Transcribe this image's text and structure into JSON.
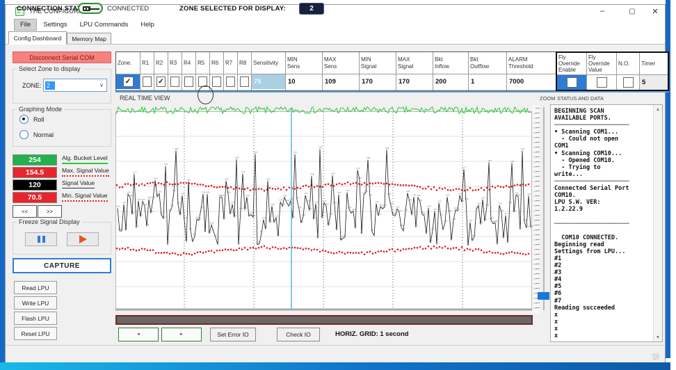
{
  "window": {
    "title": "THE CONFIGURATOR",
    "minimize": "–",
    "maximize": "▢",
    "close": "✕"
  },
  "menu": {
    "items": [
      {
        "label": "File",
        "focused": true
      },
      {
        "label": "Settings",
        "focused": false
      },
      {
        "label": "LPU Commands",
        "focused": false
      },
      {
        "label": "Help",
        "focused": false
      }
    ]
  },
  "tabs": [
    {
      "label": "Config Dashboard",
      "active": true
    },
    {
      "label": "Memory Map",
      "active": false
    }
  ],
  "sidebar": {
    "disconnect_button": "Disconnect Serial COM",
    "zone_group": {
      "title": "Select Zone to display",
      "zone_label": "ZONE:",
      "zone_value": "2"
    },
    "graphing_group": {
      "title": "Graphing Mode",
      "options": [
        {
          "label": "Roll",
          "selected": true
        },
        {
          "label": "Normal",
          "selected": false
        }
      ]
    },
    "legend": [
      {
        "value": "254",
        "label": "Alg. Bucket Level",
        "box_color": "#22b14c",
        "line": "green-solid"
      },
      {
        "value": "154.5",
        "label": "Max. Signal Value",
        "box_color": "#e8252c",
        "line": "red-dotted"
      },
      {
        "value": "120",
        "label": "Signal Value",
        "box_color": "#000000",
        "line": "black-solid"
      },
      {
        "value": "70.5",
        "label": "Min. Signal Value",
        "box_color": "#e8252c",
        "line": "red-dotted"
      }
    ],
    "nav_prev": "<<",
    "nav_next": ">>",
    "freeze_group": {
      "title": "Freeze Signal Display"
    },
    "capture_button": "CAPTURE",
    "lpu_buttons": [
      "Read LPU",
      "Write LPU",
      "Flash LPU",
      "Reset LPU"
    ]
  },
  "config_table": {
    "columns": [
      {
        "label": "Zone.",
        "type": "checkbox",
        "checked": true,
        "cell_bg": "#2f7cd6"
      },
      {
        "label": "R1",
        "type": "checkbox",
        "checked": false
      },
      {
        "label": "R2",
        "type": "checkbox",
        "checked": true
      },
      {
        "label": "R3",
        "type": "checkbox",
        "checked": false
      },
      {
        "label": "R4",
        "type": "checkbox",
        "checked": false
      },
      {
        "label": "R5",
        "type": "checkbox",
        "checked": false
      },
      {
        "label": "R6",
        "type": "checkbox",
        "checked": false
      },
      {
        "label": "R7",
        "type": "checkbox",
        "checked": false
      },
      {
        "label": "R8",
        "type": "checkbox",
        "checked": false
      },
      {
        "label": "Sensitivity",
        "type": "value",
        "value": "75",
        "cell_bg": "#abd0e4",
        "value_color": "#f2f8fb"
      },
      {
        "label": "MIN\nSens",
        "type": "value",
        "value": "10"
      },
      {
        "label": "MAX\nSens",
        "type": "value",
        "value": "109"
      },
      {
        "label": "MIN\nSignal",
        "type": "value",
        "value": "170"
      },
      {
        "label": "MAX\nSignal",
        "type": "value",
        "value": "170"
      },
      {
        "label": "Bkt\nInflow",
        "type": "value",
        "value": "200"
      },
      {
        "label": "Bkt\nOutflow",
        "type": "value",
        "value": "1"
      },
      {
        "label": "ALARM\nThreshold",
        "type": "value",
        "value": "7000"
      },
      {
        "label": "Fly\nOverride\nEnable",
        "type": "checkbox",
        "checked": false,
        "cell_bg": "#2f7cd6",
        "group": 2
      },
      {
        "label": "Fly\nOverride\nValue",
        "type": "checkbox",
        "checked": false,
        "group": 2
      },
      {
        "label": "N.O.",
        "type": "checkbox",
        "checked": false,
        "group": 2
      },
      {
        "label": "Timer",
        "type": "value",
        "value": "5",
        "cell_bg": "#ececec",
        "group": 2
      }
    ]
  },
  "realtime": {
    "title": "REAL TIME VIEW"
  },
  "zoom_panel": {
    "label": "ZOOM"
  },
  "status_panel": {
    "title": "STATUS AND DATA",
    "log": [
      "BEGINNING SCAN",
      "AVAILABLE PORTS.",
      "─────────────────────",
      "• Scanning COM1...",
      "  - Could not open",
      "COM1",
      "• Scanning COM10...",
      "  - Opened COM10.",
      "  - Trying to",
      "write...",
      "─────────────────────",
      "Connected Serial Port",
      "COM10.",
      "LPU S.W. VER:",
      "1.2.22.9",
      "",
      "─────────────────────",
      "",
      "  COM10 CONNECTED.",
      "Beginning read",
      "Settings from LPU...",
      "#1",
      "#2",
      "#3",
      "#4",
      "#5",
      "#6",
      "#7",
      "Reading succeeded",
      "x",
      "x",
      "x",
      "x"
    ]
  },
  "bottom": {
    "scroll_left": "◄",
    "scroll_right": "►",
    "set_error_io": "Set Error IO",
    "check_io": "Check IO",
    "horiz_grid": "HORIZ. GRID: 1 second"
  },
  "statusbar": {
    "connection_label": "CONNECTION STATUS:",
    "connection_value": "CONNECTED",
    "zone_label": "ZONE SELECTED FOR DISPLAY:",
    "zone_value": "2"
  },
  "chart_data": {
    "type": "line",
    "title": "REAL TIME VIEW",
    "x_axis": {
      "grid_interval": "1 second per division",
      "grid": "dashed vertical every division"
    },
    "y_range": [
      0,
      260
    ],
    "series": [
      {
        "name": "Alg. Bucket Level",
        "color": "#2dc937",
        "style": "solid",
        "value": 254,
        "shape": "dense flat noise band at top"
      },
      {
        "name": "Max. Signal Value",
        "color": "#e02020",
        "style": "dotted",
        "value": 154.5,
        "shape": "wavy dotted threshold"
      },
      {
        "name": "Signal Value",
        "color": "#1a1a1a",
        "style": "solid",
        "value": 120,
        "min_observed": 70.5,
        "max_observed": 200,
        "shape": "random noise between thresholds with spikes"
      },
      {
        "name": "Min. Signal Value",
        "color": "#e02020",
        "style": "dotted",
        "value": 70.5,
        "shape": "wavy dotted threshold"
      }
    ],
    "cursor": {
      "color": "#53b7e8",
      "position_fraction": 0.42
    },
    "legend_position": "left sidebar value boxes"
  }
}
